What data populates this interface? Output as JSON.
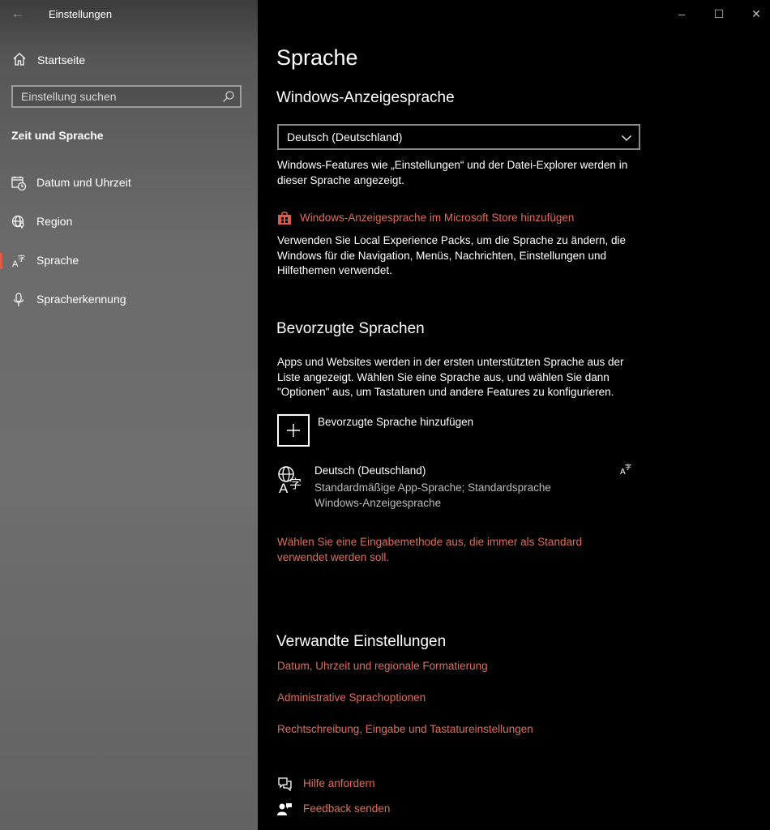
{
  "window": {
    "title": "Einstellungen",
    "minimize_glyph": "–",
    "maximize_glyph": "☐",
    "close_glyph": "✕",
    "back_glyph": "←"
  },
  "sidebar": {
    "home_label": "Startseite",
    "search_placeholder": "Einstellung suchen",
    "section_title": "Zeit und Sprache",
    "items": [
      {
        "label": "Datum und Uhrzeit",
        "icon": "calendar-clock-icon",
        "selected": false
      },
      {
        "label": "Region",
        "icon": "globe-pin-icon",
        "selected": false
      },
      {
        "label": "Sprache",
        "icon": "language-icon",
        "selected": true
      },
      {
        "label": "Spracherkennung",
        "icon": "microphone-icon",
        "selected": false
      }
    ]
  },
  "main": {
    "page_title": "Sprache",
    "display_language": {
      "heading": "Windows-Anzeigesprache",
      "selected_value": "Deutsch (Deutschland)",
      "description_line1": "Windows-Features wie „Einstellungen“ und der Datei-Explorer werden in",
      "description_line2": "dieser Sprache angezeigt.",
      "store_link": "Windows-Anzeigesprache im Microsoft Store hinzufügen",
      "lxp_line1": "Verwenden Sie Local Experience Packs, um die Sprache zu ändern, die",
      "lxp_line2": "Windows für die Navigation, Menüs, Nachrichten, Einstellungen und",
      "lxp_line3": "Hilfethemen verwendet."
    },
    "preferred": {
      "heading": "Bevorzugte Sprachen",
      "desc_line1": "Apps und Websites werden in der ersten unterstützten Sprache aus der",
      "desc_line2": "Liste angezeigt. Wählen Sie eine Sprache aus, und wählen Sie dann",
      "desc_line3": "\"Optionen\" aus, um Tastaturen und andere Features zu konfigurieren.",
      "add_label": "Bevorzugte Sprache hinzufügen",
      "language_name": "Deutsch (Deutschland)",
      "language_detail_line1": "Standardmäßige App-Sprache; Standardsprache",
      "language_detail_line2": "Windows-Anzeigesprache",
      "input_method_link_line1": "Wählen Sie eine Eingabemethode aus, die immer als Standard",
      "input_method_link_line2": "verwendet werden soll."
    },
    "related": {
      "heading": "Verwandte Einstellungen",
      "links": [
        "Datum, Uhrzeit und regionale Formatierung",
        "Administrative Sprachoptionen",
        "Rechtschreibung, Eingabe und Tastatureinstellungen"
      ]
    },
    "help_link": "Hilfe anfordern",
    "feedback_link": "Feedback senden"
  },
  "colors": {
    "accent": "#e06c5a",
    "background": "#000000",
    "sidebar": "#6b6b6b"
  }
}
